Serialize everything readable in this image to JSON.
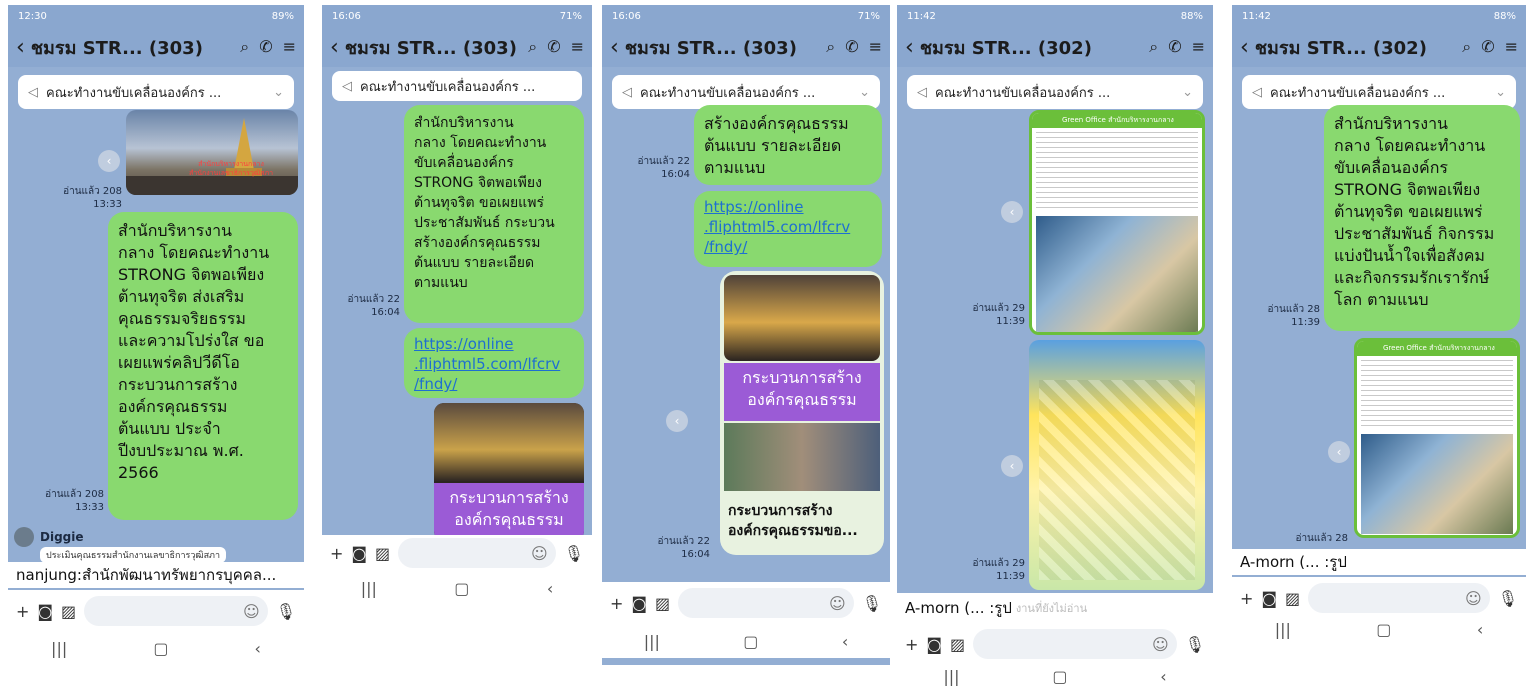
{
  "phones": [
    {
      "status_time": "12:30",
      "status_right": "89%",
      "title": "ชมรม STR... (303)",
      "notice": "คณะทำงานขับเคลื่อนองค์กร ...",
      "photo_caption": "สำนักบริหารงานกลาง\nสำนักงานเลขาธิการวุฒิสภา",
      "photo_meta": "อ่านแล้ว 208\n13:33",
      "message": "สำนักบริหารงาน\nกลาง โดยคณะทำงาน\nSTRONG จิตพอเพียง\nต้านทุจริต ส่งเสริม\nคุณธรรมจริยธรรม\nและความโปร่งใส ขอ\nเผยแพร่คลิปวีดีโอ\nกระบวนการสร้าง\nองค์กรคุณธรรม\nต้นแบบ ประจำ\nปีงบประมาณ พ.ศ.\n2566",
      "message_meta": "อ่านแล้ว 208\n13:33",
      "sender": "Diggie",
      "sender_sub": "ประเมินคุณธรรมสำนักงานเลขาธิการวุฒิสภา",
      "strip": "nanjung:สำนักพัฒนาทรัพยากรบุคคล..."
    },
    {
      "status_time": "16:06",
      "status_right": "71%",
      "title": "ชมรม STR... (303)",
      "notice": "คณะทำงานขับเคลื่อนองค์กร ...",
      "message": "สำนักบริหารงาน\nกลาง โดยคณะทำงาน\nขับเคลื่อนองค์กร\nSTRONG จิตพอเพียง\nต้านทุจริต ขอเผยแพร่\nประชาสัมพันธ์ กระบวน\nสร้างองค์กรคุณธรรม\nต้นแบบ รายละเอียด\nตามแนบ",
      "message_meta": "อ่านแล้ว 22\n16:04",
      "link": "https://online\n.fliphtml5.com/lfcrv\n/fndy/",
      "poster_text": "กระบวนการสร้าง\nองค์กรคุณธรรม"
    },
    {
      "status_time": "16:06",
      "status_right": "71%",
      "title": "ชมรม STR... (303)",
      "notice": "คณะทำงานขับเคลื่อนองค์กร ...",
      "message": "สร้างองค์กรคุณธรรม\nต้นแบบ รายละเอียด\nตามแนบ",
      "message_meta": "อ่านแล้ว 22\n16:04",
      "link": "https://online\n.fliphtml5.com/lfcrv\n/fndy/",
      "poster_text": "กระบวนการสร้าง\nองค์กรคุณธรรม",
      "card_caption": "กระบวนการสร้าง\nองค์กรคุณธรรมขอ...",
      "card_meta": "อ่านแล้ว 22\n16:04"
    },
    {
      "status_time": "11:42",
      "status_right": "88%",
      "title": "ชมรม STR... (302)",
      "notice": "คณะทำงานขับเคลื่อนองค์กร ...",
      "poster_title": "Green Office สำนักบริหารงานกลาง",
      "poster1_meta": "อ่านแล้ว 29\n11:39",
      "poster2_meta": "อ่านแล้ว 29\n11:39",
      "strip": "A-morn (... :รูป",
      "strip_sub": "งานที่ยังไม่อ่าน"
    },
    {
      "status_time": "11:42",
      "status_right": "88%",
      "title": "ชมรม STR... (302)",
      "notice": "คณะทำงานขับเคลื่อนองค์กร ...",
      "message": "สำนักบริหารงาน\nกลาง โดยคณะทำงาน\nขับเคลื่อนองค์กร\nSTRONG จิตพอเพียง\nต้านทุจริต ขอเผยแพร่\nประชาสัมพันธ์ กิจกรรม\nแบ่งปันน้ำใจเพื่อสังคม\nและกิจกรรมรักเรารักษ์\nโลก ตามแนบ",
      "message_meta": "อ่านแล้ว 28\n11:39",
      "poster_title": "Green Office สำนักบริหารงานกลาง",
      "poster_meta": "อ่านแล้ว 28",
      "strip": "A-morn (... :รูป"
    }
  ],
  "colors": {
    "header_bg": "#8aa7cf",
    "chat_bg": "#93aed3",
    "bubble": "#89d96f",
    "link": "#1e6fd1",
    "purple_banner": "#9b5bd6"
  },
  "icons": [
    "back-icon",
    "search-icon",
    "phone-icon",
    "menu-icon",
    "megaphone-icon",
    "chevron-down-icon",
    "share-icon",
    "plus-icon",
    "camera-icon",
    "image-icon",
    "emoji-icon",
    "mic-icon",
    "nav-recents-icon",
    "nav-home-icon",
    "nav-back-icon"
  ]
}
